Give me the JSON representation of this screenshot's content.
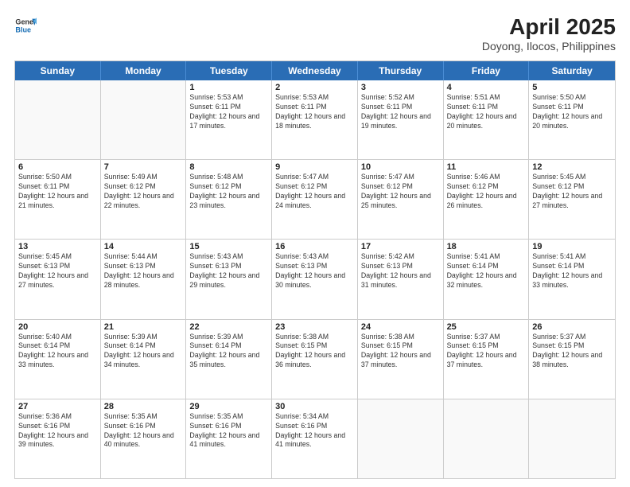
{
  "header": {
    "logo_general": "General",
    "logo_blue": "Blue",
    "title": "April 2025",
    "subtitle": "Doyong, Ilocos, Philippines"
  },
  "days_of_week": [
    "Sunday",
    "Monday",
    "Tuesday",
    "Wednesday",
    "Thursday",
    "Friday",
    "Saturday"
  ],
  "weeks": [
    [
      {
        "day": "",
        "detail": "",
        "empty": true
      },
      {
        "day": "",
        "detail": "",
        "empty": true
      },
      {
        "day": "1",
        "detail": "Sunrise: 5:53 AM\nSunset: 6:11 PM\nDaylight: 12 hours and 17 minutes."
      },
      {
        "day": "2",
        "detail": "Sunrise: 5:53 AM\nSunset: 6:11 PM\nDaylight: 12 hours and 18 minutes."
      },
      {
        "day": "3",
        "detail": "Sunrise: 5:52 AM\nSunset: 6:11 PM\nDaylight: 12 hours and 19 minutes."
      },
      {
        "day": "4",
        "detail": "Sunrise: 5:51 AM\nSunset: 6:11 PM\nDaylight: 12 hours and 20 minutes."
      },
      {
        "day": "5",
        "detail": "Sunrise: 5:50 AM\nSunset: 6:11 PM\nDaylight: 12 hours and 20 minutes."
      }
    ],
    [
      {
        "day": "6",
        "detail": "Sunrise: 5:50 AM\nSunset: 6:11 PM\nDaylight: 12 hours and 21 minutes."
      },
      {
        "day": "7",
        "detail": "Sunrise: 5:49 AM\nSunset: 6:12 PM\nDaylight: 12 hours and 22 minutes."
      },
      {
        "day": "8",
        "detail": "Sunrise: 5:48 AM\nSunset: 6:12 PM\nDaylight: 12 hours and 23 minutes."
      },
      {
        "day": "9",
        "detail": "Sunrise: 5:47 AM\nSunset: 6:12 PM\nDaylight: 12 hours and 24 minutes."
      },
      {
        "day": "10",
        "detail": "Sunrise: 5:47 AM\nSunset: 6:12 PM\nDaylight: 12 hours and 25 minutes."
      },
      {
        "day": "11",
        "detail": "Sunrise: 5:46 AM\nSunset: 6:12 PM\nDaylight: 12 hours and 26 minutes."
      },
      {
        "day": "12",
        "detail": "Sunrise: 5:45 AM\nSunset: 6:12 PM\nDaylight: 12 hours and 27 minutes."
      }
    ],
    [
      {
        "day": "13",
        "detail": "Sunrise: 5:45 AM\nSunset: 6:13 PM\nDaylight: 12 hours and 27 minutes."
      },
      {
        "day": "14",
        "detail": "Sunrise: 5:44 AM\nSunset: 6:13 PM\nDaylight: 12 hours and 28 minutes."
      },
      {
        "day": "15",
        "detail": "Sunrise: 5:43 AM\nSunset: 6:13 PM\nDaylight: 12 hours and 29 minutes."
      },
      {
        "day": "16",
        "detail": "Sunrise: 5:43 AM\nSunset: 6:13 PM\nDaylight: 12 hours and 30 minutes."
      },
      {
        "day": "17",
        "detail": "Sunrise: 5:42 AM\nSunset: 6:13 PM\nDaylight: 12 hours and 31 minutes."
      },
      {
        "day": "18",
        "detail": "Sunrise: 5:41 AM\nSunset: 6:14 PM\nDaylight: 12 hours and 32 minutes."
      },
      {
        "day": "19",
        "detail": "Sunrise: 5:41 AM\nSunset: 6:14 PM\nDaylight: 12 hours and 33 minutes."
      }
    ],
    [
      {
        "day": "20",
        "detail": "Sunrise: 5:40 AM\nSunset: 6:14 PM\nDaylight: 12 hours and 33 minutes."
      },
      {
        "day": "21",
        "detail": "Sunrise: 5:39 AM\nSunset: 6:14 PM\nDaylight: 12 hours and 34 minutes."
      },
      {
        "day": "22",
        "detail": "Sunrise: 5:39 AM\nSunset: 6:14 PM\nDaylight: 12 hours and 35 minutes."
      },
      {
        "day": "23",
        "detail": "Sunrise: 5:38 AM\nSunset: 6:15 PM\nDaylight: 12 hours and 36 minutes."
      },
      {
        "day": "24",
        "detail": "Sunrise: 5:38 AM\nSunset: 6:15 PM\nDaylight: 12 hours and 37 minutes."
      },
      {
        "day": "25",
        "detail": "Sunrise: 5:37 AM\nSunset: 6:15 PM\nDaylight: 12 hours and 37 minutes."
      },
      {
        "day": "26",
        "detail": "Sunrise: 5:37 AM\nSunset: 6:15 PM\nDaylight: 12 hours and 38 minutes."
      }
    ],
    [
      {
        "day": "27",
        "detail": "Sunrise: 5:36 AM\nSunset: 6:16 PM\nDaylight: 12 hours and 39 minutes."
      },
      {
        "day": "28",
        "detail": "Sunrise: 5:35 AM\nSunset: 6:16 PM\nDaylight: 12 hours and 40 minutes."
      },
      {
        "day": "29",
        "detail": "Sunrise: 5:35 AM\nSunset: 6:16 PM\nDaylight: 12 hours and 41 minutes."
      },
      {
        "day": "30",
        "detail": "Sunrise: 5:34 AM\nSunset: 6:16 PM\nDaylight: 12 hours and 41 minutes."
      },
      {
        "day": "",
        "detail": "",
        "empty": true
      },
      {
        "day": "",
        "detail": "",
        "empty": true
      },
      {
        "day": "",
        "detail": "",
        "empty": true
      }
    ]
  ]
}
